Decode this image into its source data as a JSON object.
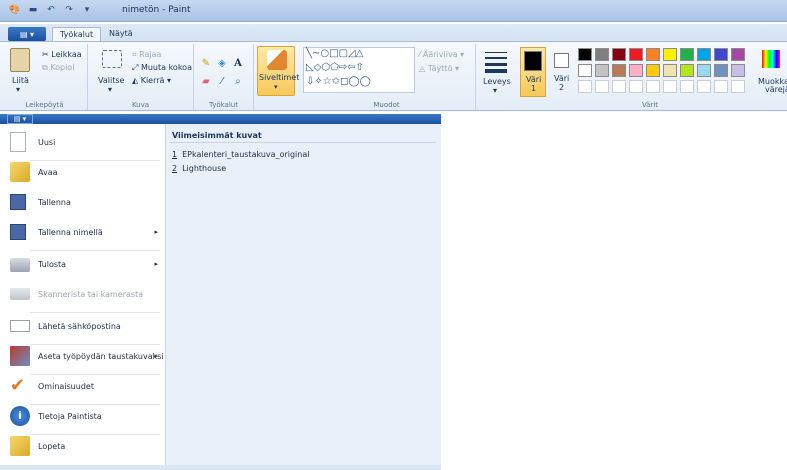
{
  "window": {
    "title": "nimetön - Paint"
  },
  "tabs": [
    {
      "label": "Työkalut"
    },
    {
      "label": "Näytä"
    }
  ],
  "ribbon": {
    "clipboard": {
      "group_label": "Leikepöytä",
      "paste": "Liitä",
      "cut": "Leikkaa",
      "copy": "Kopioi"
    },
    "image": {
      "group_label": "Kuva",
      "select": "Valitse",
      "crop": "Rajaa",
      "resize": "Muuta kokoa",
      "rotate": "Kierrä"
    },
    "tools": {
      "group_label": "Työkalut"
    },
    "brushes": {
      "label": "Siveltimet"
    },
    "shapes": {
      "group_label": "Muodot",
      "outline": "Ääriviiva",
      "fill": "Täyttö"
    },
    "size": {
      "label": "Leveys"
    },
    "colors": {
      "group_label": "Värit",
      "color1": "Väri",
      "color1_num": "1",
      "color2": "Väri",
      "color2_num": "2",
      "edit_line1": "Muokkaa",
      "edit_line2": "värejä",
      "color1_value": "#000000",
      "color2_value": "#ffffff",
      "palette_row1": [
        "#000000",
        "#7f7f7f",
        "#880015",
        "#ed1c24",
        "#ff7f27",
        "#fff200",
        "#22b14c",
        "#00a2e8",
        "#3f48cc",
        "#a349a4"
      ],
      "palette_row2": [
        "#ffffff",
        "#c3c3c3",
        "#b97a57",
        "#ffaec9",
        "#ffc90e",
        "#efe4b0",
        "#b5e61d",
        "#99d9ea",
        "#7092be",
        "#c8bfe7"
      ]
    }
  },
  "file_menu": {
    "items": [
      {
        "label": "Uusi"
      },
      {
        "label": "Avaa"
      },
      {
        "label": "Tallenna"
      },
      {
        "label": "Tallenna nimellä"
      },
      {
        "label": "Tulosta"
      },
      {
        "label": "Skanneri­sta tai kamerasta"
      },
      {
        "label": "Lähetä sähköpostina"
      },
      {
        "label": "Aseta työpöydän taustakuvaksi"
      },
      {
        "label": "Ominaisuudet"
      },
      {
        "label": "Tietoja Paintista"
      },
      {
        "label": "Lopeta"
      }
    ],
    "recent_title": "Viimeisimmät kuvat",
    "recent": [
      {
        "num": "1",
        "name": "EPkalenteri_taustakuva_original"
      },
      {
        "num": "2",
        "name": "Lighthouse"
      }
    ]
  }
}
